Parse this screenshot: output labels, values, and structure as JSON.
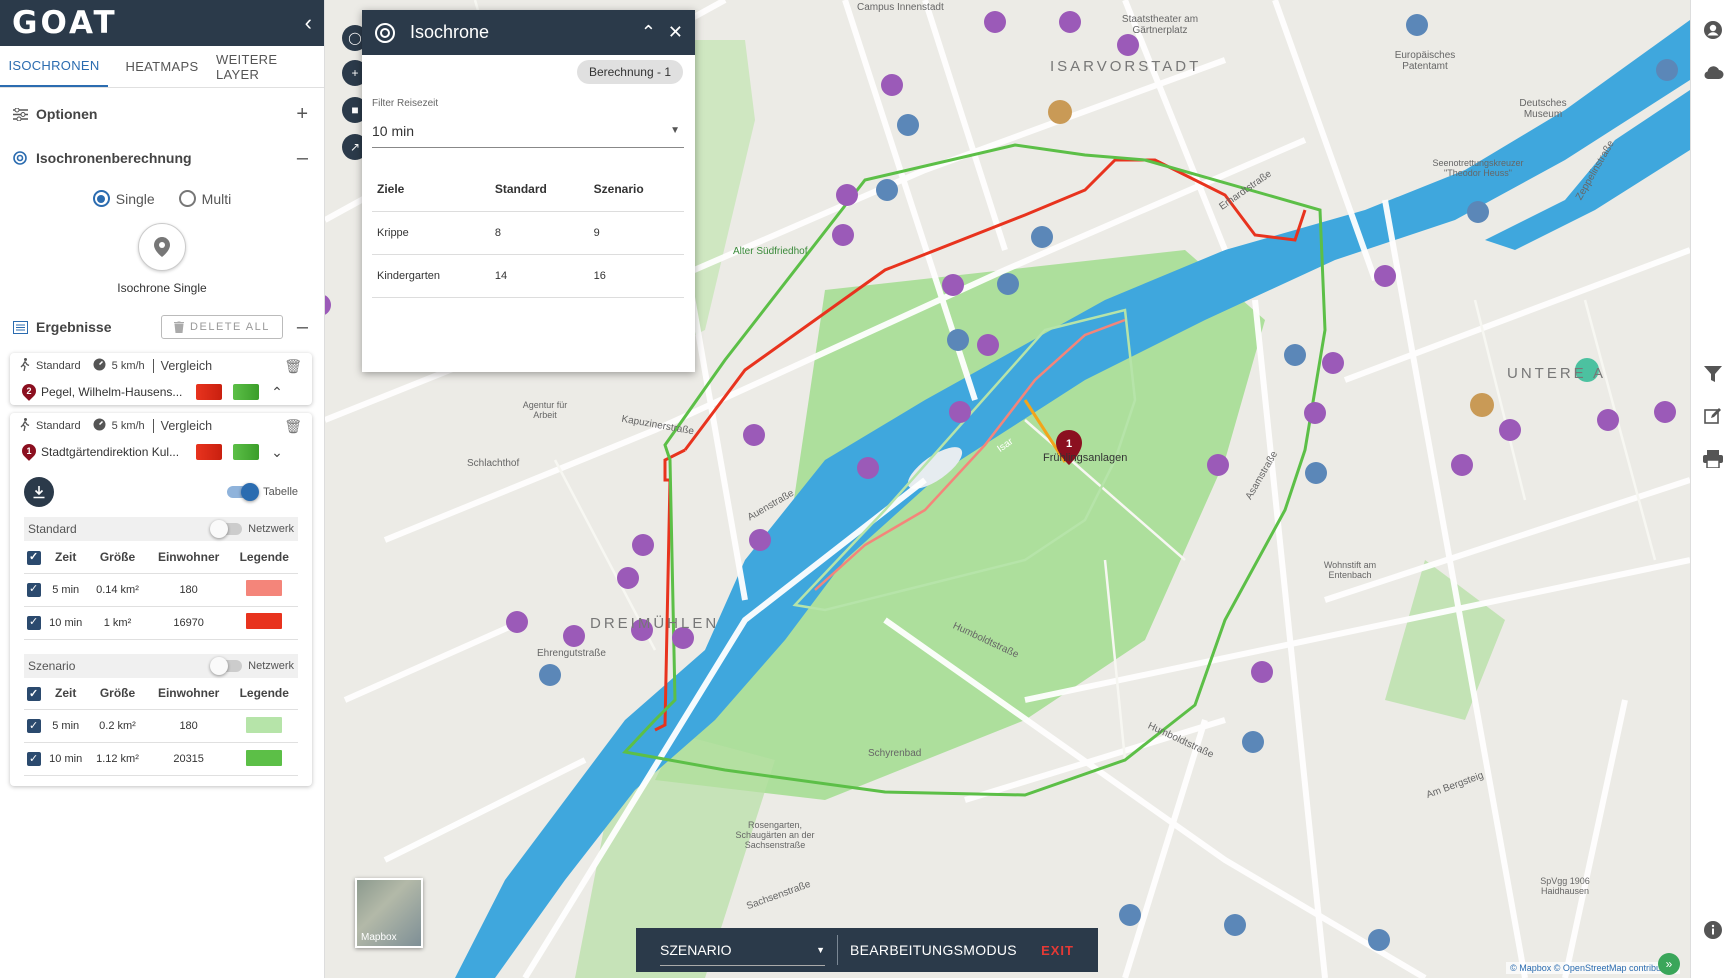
{
  "app": {
    "logo": "GOAT"
  },
  "tabs": [
    {
      "label": "ISOCHRONEN",
      "active": true
    },
    {
      "label": "HEATMAPS",
      "active": false
    },
    {
      "label": "WEITERE LAYER",
      "active": false
    }
  ],
  "sections": {
    "options": "Optionen",
    "calculation": "Isochronenberechnung"
  },
  "mode": {
    "single": "Single",
    "multi": "Multi",
    "selected": "single"
  },
  "iso_single_label": "Isochrone Single",
  "results": {
    "title": "Ergebnisse",
    "delete_all": "DELETE ALL",
    "cards": [
      {
        "mode": "Standard",
        "speed": "5 km/h",
        "compare": "Vergleich",
        "number": "2",
        "address": "Pegel, Wilhelm-Hausens...",
        "color_a": "#e8331e",
        "color_b": "#5cbf47"
      },
      {
        "mode": "Standard",
        "speed": "5 km/h",
        "compare": "Vergleich",
        "number": "1",
        "address": "Stadtgärtendirektion Kul...",
        "color_a": "#e8331e",
        "color_b": "#5cbf47",
        "table_toggle_label": "Tabelle",
        "standard": {
          "title": "Standard",
          "network_label": "Netzwerk",
          "headers": [
            "Zeit",
            "Größe",
            "Einwohner",
            "Legende"
          ],
          "rows": [
            {
              "time": "5 min",
              "size": "0.14 km²",
              "pop": "180",
              "color": "#f4857a"
            },
            {
              "time": "10 min",
              "size": "1 km²",
              "pop": "16970",
              "color": "#e8331e"
            }
          ]
        },
        "scenario": {
          "title": "Szenario",
          "network_label": "Netzwerk",
          "headers": [
            "Zeit",
            "Größe",
            "Einwohner",
            "Legende"
          ],
          "rows": [
            {
              "time": "5 min",
              "size": "0.2 km²",
              "pop": "180",
              "color": "#b6e4a9"
            },
            {
              "time": "10 min",
              "size": "1.12 km²",
              "pop": "20315",
              "color": "#5cbf47"
            }
          ]
        }
      }
    ]
  },
  "iso_panel": {
    "title": "Isochrone",
    "chip": "Berechnung - 1",
    "filter_label": "Filter Reisezeit",
    "filter_value": "10 min",
    "headers": [
      "Ziele",
      "Standard",
      "Szenario"
    ],
    "rows": [
      {
        "target": "Krippe",
        "standard": "8",
        "scenario": "9"
      },
      {
        "target": "Kindergarten",
        "standard": "14",
        "scenario": "16"
      }
    ]
  },
  "bottom_bar": {
    "scenario": "SZENARIO",
    "edit_mode": "BEARBEITUNGSMODUS",
    "exit": "EXIT"
  },
  "map": {
    "thumb_label": "Mapbox",
    "attribution_mapbox": "© Mapbox",
    "attribution_osm": "© OpenStreetMap contributors",
    "districts": [
      "ISARVORSTADT",
      "UNTERE A",
      "DREIMÜHLEN"
    ],
    "labels": [
      "Campus Innenstadt",
      "Staatstheater am Gärtnerplatz",
      "Europäisches Patentamt",
      "Deutsches Museum",
      "Seenotrettungskreuzer \"Theodor Heuss\"",
      "Alter Südfriedhof",
      "Agentur für Arbeit",
      "Schlachthof",
      "Frühlingsanlagen",
      "Wohnstift am Entenbach",
      "Schyrenbad",
      "Rosengarten, Schaugärten an der Sachsenstraße",
      "SpVgg 1906 Haidhausen",
      "Isar",
      "Auenstraße",
      "Ehrengutstraße",
      "Humboldtstraße",
      "Kapuzinerstraße",
      "Erhardtstraße",
      "Zeppelinstraße",
      "Asamstraße",
      "Am Bergsteig",
      "Sachsenstraße",
      "Humboldtstraße"
    ]
  },
  "colors": {
    "header": "#2b3a4a",
    "accent": "#2b6cb0",
    "iso_standard": "#e8331e",
    "iso_scenario": "#5cbf47",
    "water": "#3fa7dd",
    "park": "#9fdc8b"
  }
}
